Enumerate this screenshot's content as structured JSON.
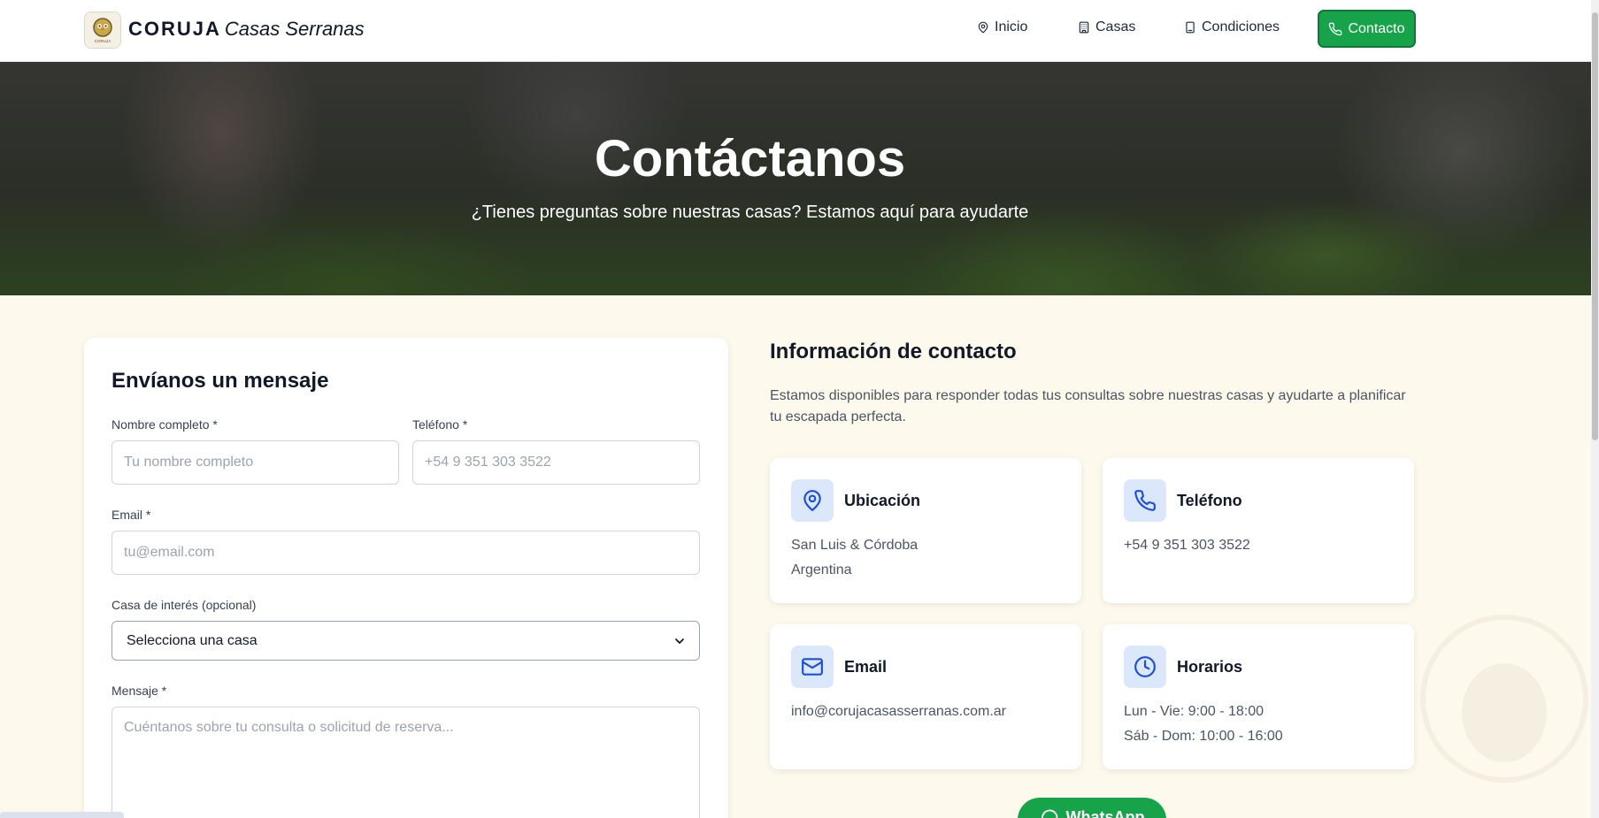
{
  "header": {
    "brand_bold": "CORUJA",
    "brand_italic": "Casas Serranas",
    "logo_text": "CORUJA",
    "nav": [
      {
        "label": "Inicio",
        "icon": "map-pin-icon"
      },
      {
        "label": "Casas",
        "icon": "building-icon"
      },
      {
        "label": "Condiciones",
        "icon": "document-icon"
      }
    ],
    "cta_label": "Contacto",
    "cta_icon": "phone-icon"
  },
  "hero": {
    "title": "Contáctanos",
    "subtitle": "¿Tienes preguntas sobre nuestras casas? Estamos aquí para ayudarte"
  },
  "form": {
    "title": "Envíanos un mensaje",
    "name_label": "Nombre completo *",
    "name_placeholder": "Tu nombre completo",
    "phone_label": "Teléfono *",
    "phone_placeholder": "+54 9 351 303 3522",
    "email_label": "Email *",
    "email_placeholder": "tu@email.com",
    "house_label": "Casa de interés (opcional)",
    "house_selected": "Selecciona una casa",
    "message_label": "Mensaje *",
    "message_placeholder": "Cuéntanos sobre tu consulta o solicitud de reserva..."
  },
  "info": {
    "title": "Información de contacto",
    "description": "Estamos disponibles para responder todas tus consultas sobre nuestras casas y ayudarte a planificar tu escapada perfecta.",
    "cards": [
      {
        "title": "Ubicación",
        "icon": "map-pin-icon",
        "lines": [
          "San Luis & Córdoba",
          "Argentina"
        ]
      },
      {
        "title": "Teléfono",
        "icon": "phone-icon",
        "lines": [
          "+54 9 351 303 3522"
        ]
      },
      {
        "title": "Email",
        "icon": "mail-icon",
        "lines": [
          "info@corujacasasserranas.com.ar"
        ]
      },
      {
        "title": "Horarios",
        "icon": "clock-icon",
        "lines": [
          "Lun - Vie: 9:00 - 18:00",
          "Sáb - Dom: 10:00 - 16:00"
        ]
      }
    ]
  },
  "whatsapp": {
    "label": "WhatsApp",
    "icon": "whatsapp-icon"
  },
  "colors": {
    "accent": "#16a34a",
    "icon_blue": "#1d4ed8",
    "icon_bg": "#dbe8fb",
    "page_bg": "#fdf9ec"
  }
}
